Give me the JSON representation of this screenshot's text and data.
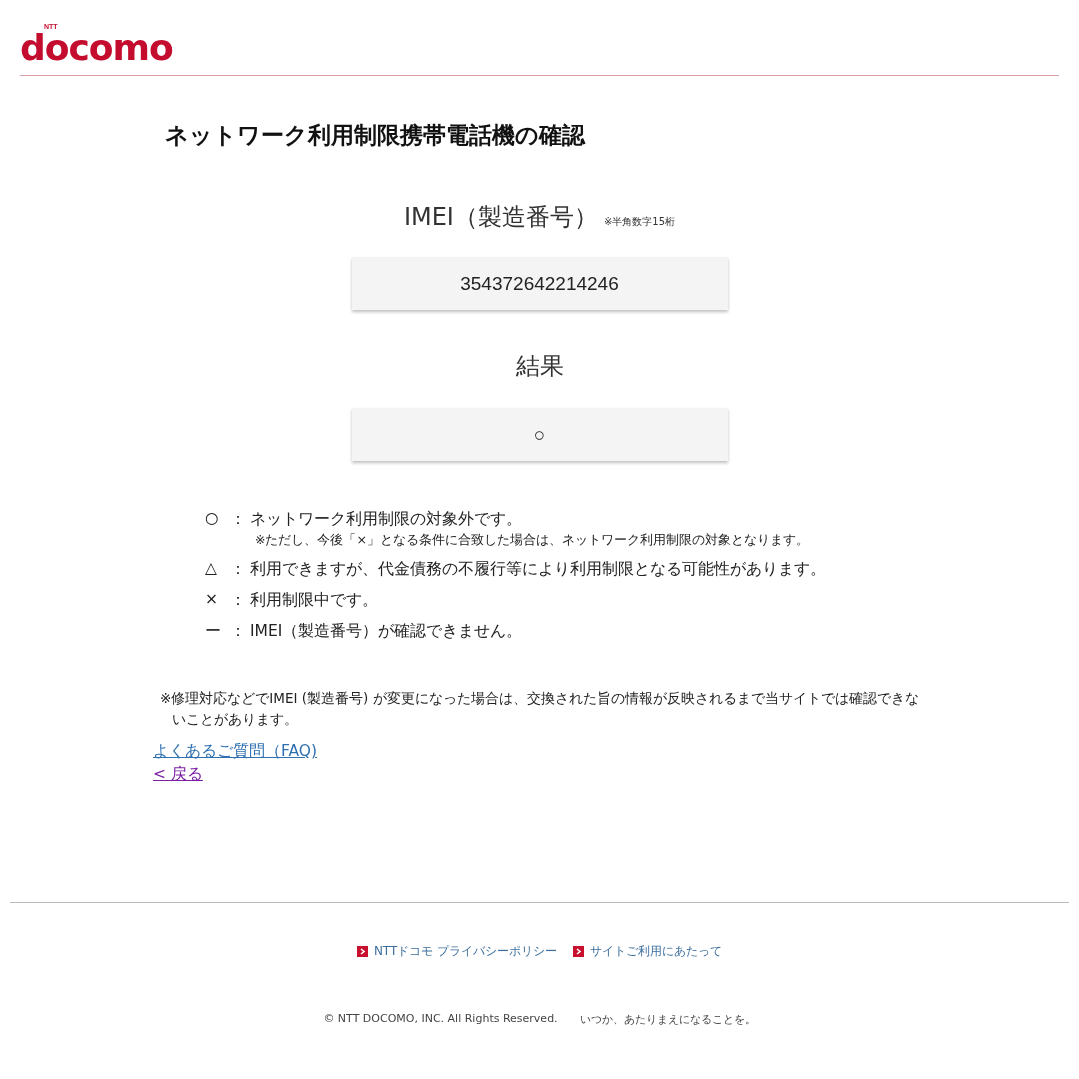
{
  "header": {
    "logo_small": "NTT",
    "logo": "docomo"
  },
  "title": "ネットワーク利用制限携帯電話機の確認",
  "imei": {
    "label": "IMEI（製造番号）",
    "hint": "※半角数字15桁",
    "value": "354372642214246"
  },
  "result": {
    "label": "結果",
    "value": "○"
  },
  "legend": [
    {
      "symbol": "○",
      "colon": "：",
      "text": "ネットワーク利用制限の対象外です。",
      "note": "※ただし、今後「×」となる条件に合致した場合は、ネットワーク利用制限の対象となります。"
    },
    {
      "symbol": "△",
      "colon": "：",
      "text": "利用できますが、代金債務の不履行等により利用制限となる可能性があります。"
    },
    {
      "symbol": "×",
      "colon": "：",
      "text": "利用制限中です。"
    },
    {
      "symbol": "ー",
      "colon": "：",
      "text": "IMEI（製造番号）が確認できません。"
    }
  ],
  "notice": "※修理対応などでIMEI (製造番号) が変更になった場合は、交換された旨の情報が反映されるまで当サイトでは確認できないことがあります。",
  "links": [
    {
      "text": "よくあるご質問（FAQ)",
      "visited": false
    },
    {
      "text": "< 戻る",
      "visited": true
    }
  ],
  "footer": {
    "links": [
      "NTTドコモ プライバシーポリシー",
      "サイトご利用にあたって"
    ],
    "copyright": "© NTT DOCOMO, INC. All Rights Reserved.",
    "slogan": "いつか、あたりまえになることを。"
  }
}
